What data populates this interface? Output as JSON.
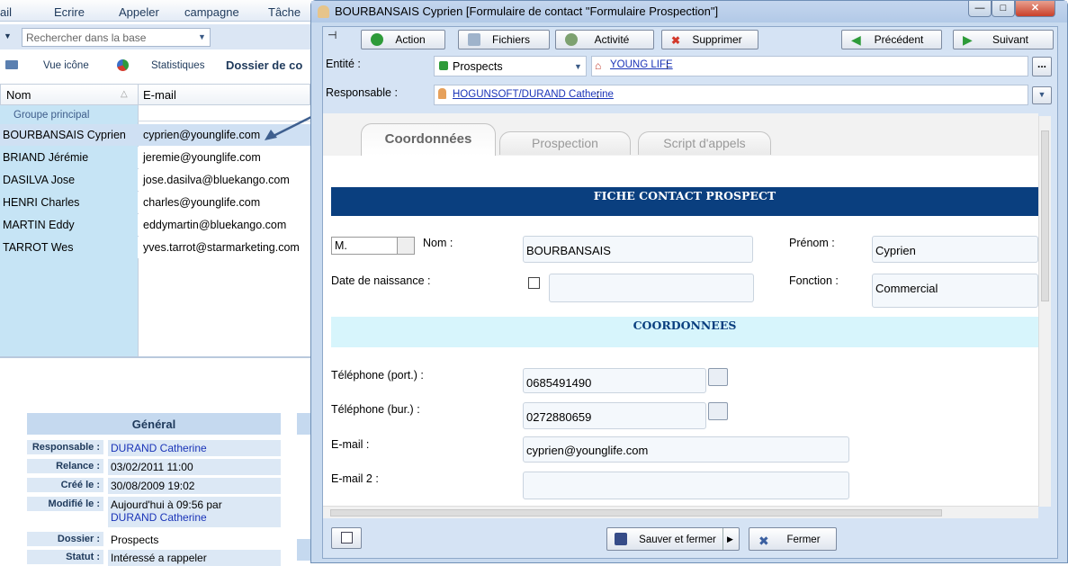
{
  "toolbar": {
    "items": [
      "ail",
      "Ecrire",
      "Appeler",
      "campagne",
      "Tâche"
    ]
  },
  "search": {
    "placeholder": "Rechercher dans la base"
  },
  "nav": {
    "vue_icone": "Vue icône",
    "statistiques": "Statistiques",
    "dossier": "Dossier de co"
  },
  "grid": {
    "col_nom": "Nom",
    "col_email": "E-mail",
    "group": "Groupe principal",
    "rows": [
      {
        "nom": "BOURBANSAIS Cyprien",
        "email": "cyprien@younglife.com"
      },
      {
        "nom": "BRIAND Jérémie",
        "email": "jeremie@younglife.com"
      },
      {
        "nom": "DASILVA Jose",
        "email": "jose.dasilva@bluekango.com"
      },
      {
        "nom": "HENRI Charles",
        "email": "charles@younglife.com"
      },
      {
        "nom": "MARTIN Eddy",
        "email": "eddymartin@bluekango.com"
      },
      {
        "nom": "TARROT Wes",
        "email": "yves.tarrot@starmarketing.com"
      }
    ]
  },
  "detail": {
    "section": "Général",
    "responsable_l": "Responsable :",
    "responsable_v": "DURAND Catherine",
    "relance_l": "Relance :",
    "relance_v": "03/02/2011 11:00",
    "cree_l": "Créé le :",
    "cree_v": "30/08/2009 19:02",
    "modifie_l": "Modifié le :",
    "modifie_v1": "Aujourd'hui à 09:56 par",
    "modifie_v2": "DURAND Catherine",
    "dossier_l": "Dossier :",
    "dossier_v": "Prospects",
    "statut_l": "Statut :",
    "statut_v": "Intéressé a rappeler"
  },
  "dialog": {
    "title": "BOURBANSAIS Cyprien [Formulaire de contact \"Formulaire Prospection\"]",
    "buttons": {
      "action": "Action",
      "fichiers": "Fichiers",
      "activite": "Activité",
      "supprimer": "Supprimer",
      "precedent": "Précédent",
      "suivant": "Suivant"
    },
    "entite_label": "Entité :",
    "entite_value": "Prospects",
    "entite_link": "YOUNG LIFE",
    "responsable_label": "Responsable :",
    "responsable_link": "HOGUNSOFT/DURAND Catherine",
    "tabs": [
      "Coordonnées",
      "Prospection",
      "Script d'appels"
    ],
    "header1": "FICHE CONTACT PROSPECT",
    "header2": "COORDONNEES",
    "civilite": "M.",
    "nom_label": "Nom :",
    "nom_value": "BOURBANSAIS",
    "prenom_label": "Prénom :",
    "prenom_value": "Cyprien",
    "naissance_label": "Date de naissance :",
    "fonction_label": "Fonction :",
    "fonction_value": "Commercial",
    "tel_port_label": "Téléphone (port.) :",
    "tel_port_value": "0685491490",
    "tel_bur_label": "Téléphone (bur.) :",
    "tel_bur_value": "0272880659",
    "email_label": "E-mail :",
    "email_value": "cyprien@younglife.com",
    "email2_label": "E-mail 2 :",
    "email2_value": "",
    "save_close": "Sauver et fermer",
    "close": "Fermer"
  },
  "colors": {
    "header_dark": "#0a3f7f",
    "header_light": "#d7f5fc",
    "selection": "#cfe0f3",
    "name_col": "#c6e4f5"
  }
}
